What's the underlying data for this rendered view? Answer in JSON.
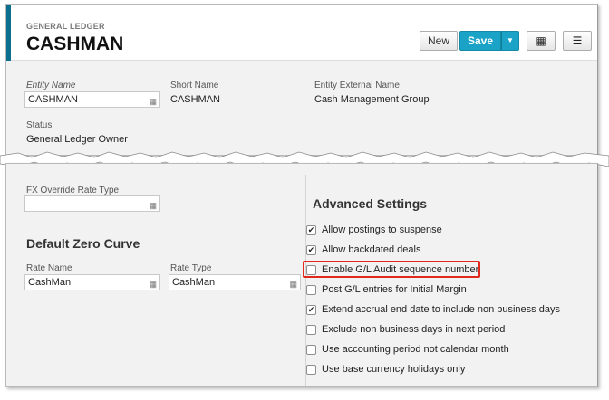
{
  "header": {
    "breadcrumb": "GENERAL LEDGER",
    "title": "CASHMAN",
    "new_label": "New",
    "save_label": "Save"
  },
  "details": {
    "entity_name_label": "Entity Name",
    "entity_name_value": "CASHMAN",
    "short_name_label": "Short Name",
    "short_name_value": "CASHMAN",
    "external_name_label": "Entity External Name",
    "external_name_value": "Cash Management Group",
    "status_label": "Status",
    "status_value": "General Ledger Owner"
  },
  "fx": {
    "label": "FX Override Rate Type",
    "value": ""
  },
  "zero_curve": {
    "title": "Default Zero Curve",
    "rate_name_label": "Rate Name",
    "rate_name_value": "CashMan",
    "rate_type_label": "Rate Type",
    "rate_type_value": "CashMan"
  },
  "advanced": {
    "title": "Advanced Settings",
    "options": [
      {
        "label": "Allow postings to suspense",
        "checked": true
      },
      {
        "label": "Allow backdated deals",
        "checked": true
      },
      {
        "label": "Enable G/L Audit sequence number",
        "checked": false
      },
      {
        "label": "Post G/L entries for Initial Margin",
        "checked": false
      },
      {
        "label": "Extend accrual end date to include non business days",
        "checked": true
      },
      {
        "label": "Exclude non business days in next period",
        "checked": false
      },
      {
        "label": "Use accounting period not calendar month",
        "checked": false
      },
      {
        "label": "Use base currency holidays only",
        "checked": false
      }
    ]
  },
  "colors": {
    "accent": "#0b6e8c",
    "save_button": "#1aa3c6",
    "highlight_border": "#e0281d"
  },
  "icons": {
    "grid": "grid-icon",
    "menu": "hamburger-menu-icon",
    "dropdown": "caret-down-icon",
    "lookup": "lookup-grid-icon",
    "check": "checkmark-icon"
  }
}
